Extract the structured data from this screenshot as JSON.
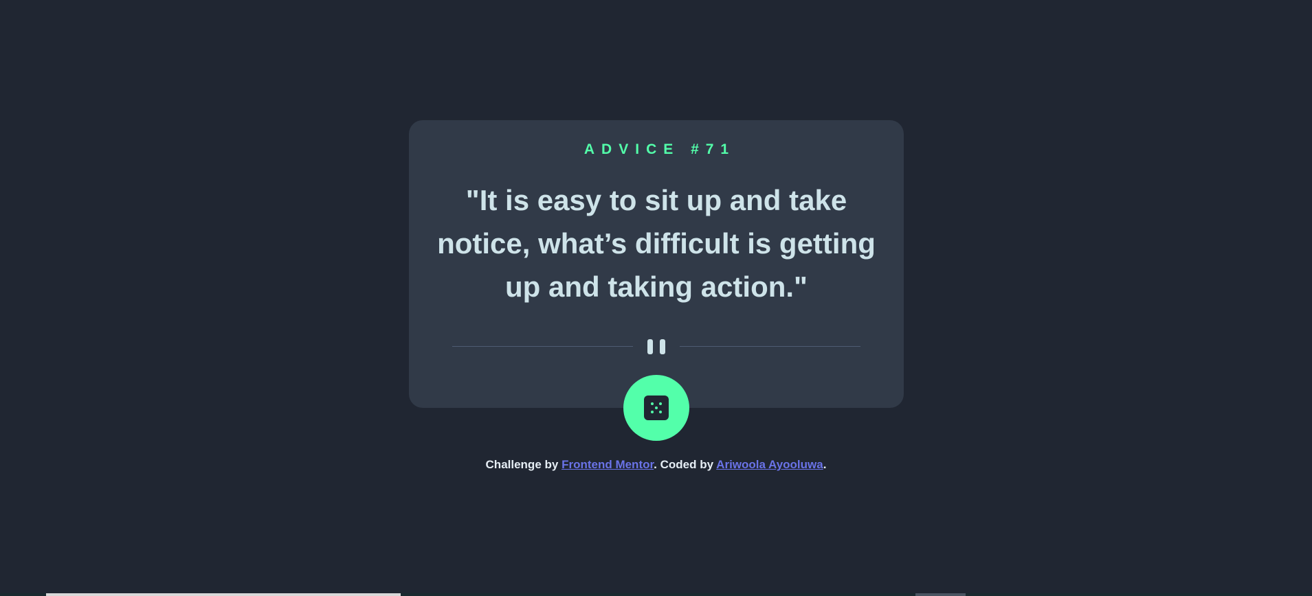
{
  "advice": {
    "label": "ADVICE #71",
    "text": "\"It is easy to sit up and take notice, what’s difficult is getting up and taking action.\""
  },
  "icons": {
    "divider": "pause-icon",
    "button": "dice-icon"
  },
  "attribution": {
    "prefix": "Challenge by ",
    "link1": "Frontend Mentor",
    "middle": ". Coded by ",
    "link2": "Ariwoola Ayooluwa",
    "suffix": "."
  },
  "colors": {
    "background": "#202632",
    "card": "#313a48",
    "accent": "#53ffaa",
    "text": "#cee3e9",
    "link": "#6a73e8"
  }
}
